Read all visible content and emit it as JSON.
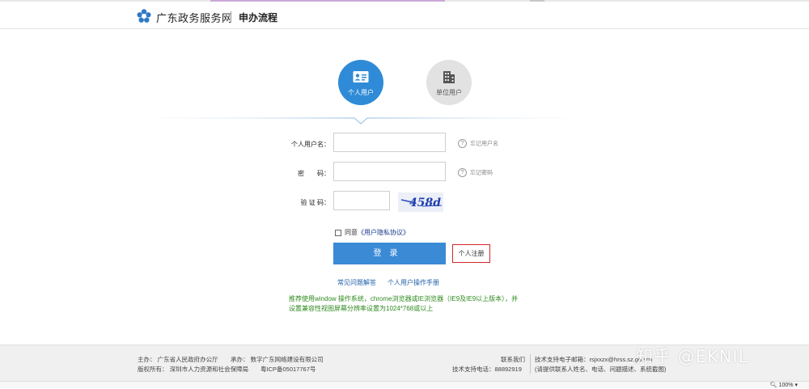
{
  "header": {
    "site_name": "广东政务服务网",
    "page_title": "申办流程"
  },
  "tabs": [
    {
      "label": "个人用户",
      "active": true,
      "icon": "id-card-icon"
    },
    {
      "label": "单位用户",
      "active": false,
      "icon": "building-icon"
    }
  ],
  "form": {
    "username_label": "个人用户名：",
    "password_label": "密　　码：",
    "captcha_label": "验  证  码：",
    "username_value": "",
    "password_value": "",
    "captcha_value": "",
    "forgot_username": "忘记用户名",
    "forgot_password": "忘记密码",
    "captcha_text": "458d",
    "agree_prefix": "同意",
    "agree_link": "《用户隐私协议》",
    "login_label": "登录",
    "register_label": "个人注册"
  },
  "links": {
    "faq": "常见问题解答",
    "manual": "个人用户操作手册"
  },
  "tip": "推荐使用window 操作系统，chrome浏览器或IE浏览器（IE9及IE9以上版本），并设置兼容性视图屏幕分辨率设置为1024*768或以上",
  "footer": {
    "sponsor": "主办：  广东省人民政府办公厅",
    "organizer": "承办：  数字广东网络建设有限公司",
    "copyright": "版权所有：  深圳市人力资源和社会保障局",
    "icp": "粤ICP备05017767号",
    "contact": "联系我们",
    "tel": "技术支持电话：88892919",
    "email": "技术支持电子邮箱：rsjxxzx@hrss.sz.gov.cn",
    "email_note": "(请提供联系人姓名、电话、问题描述、系统截图)"
  },
  "watermark": "知乎 @EKNIL",
  "status": {
    "zoom": "100%"
  },
  "colors": {
    "primary": "#3a8ad6",
    "register_border": "#d2282d",
    "tip_green": "#2e8a1e"
  }
}
